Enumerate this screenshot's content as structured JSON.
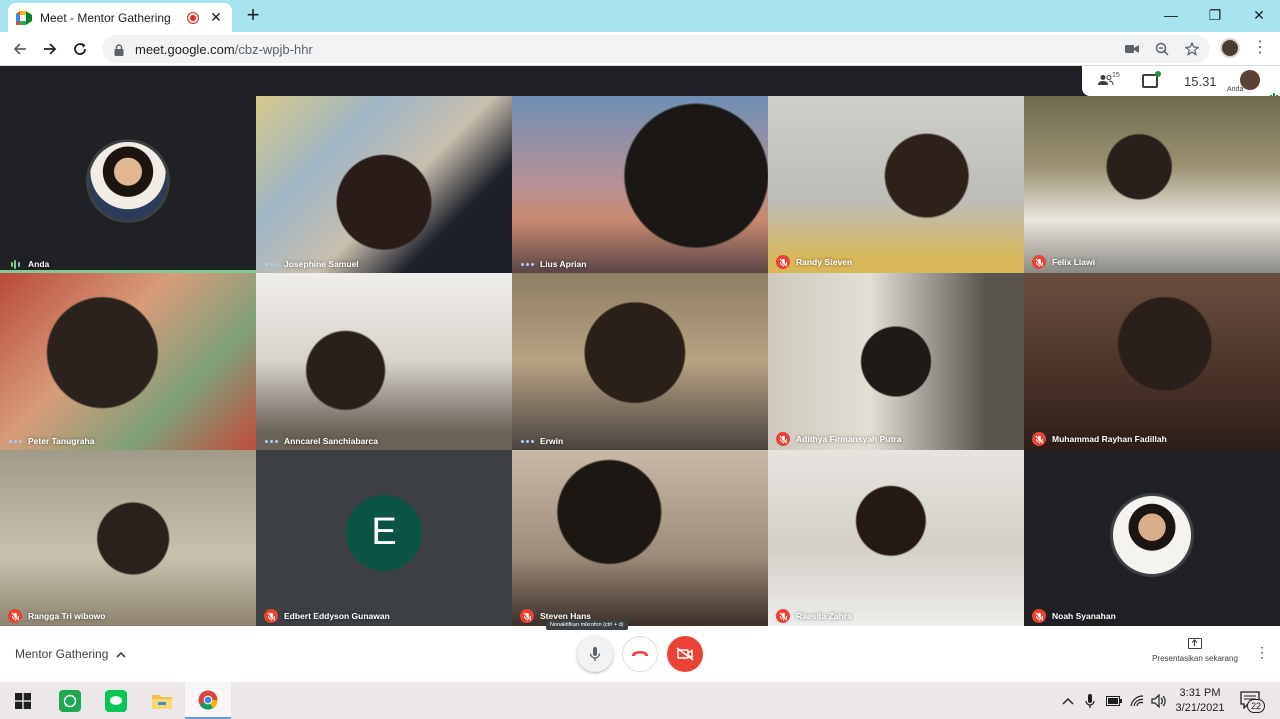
{
  "browser": {
    "tab_title": "Meet - Mentor Gathering",
    "tab_close": "✕",
    "new_tab": "+",
    "url_host": "meet.google.com",
    "url_path": "/cbz-wpjb-hhr",
    "window_minimize": "—",
    "window_restore": "❐",
    "window_close": "✕"
  },
  "meet_info": {
    "participants_count": "15",
    "time": "15.31",
    "you_label": "Anda"
  },
  "participants": [
    {
      "name": "Anda",
      "status": "speaking-self",
      "kind": "photo-avatar"
    },
    {
      "name": "Josephine Samuel",
      "status": "active",
      "kind": "video"
    },
    {
      "name": "Lius Aprian",
      "status": "active",
      "kind": "video"
    },
    {
      "name": "Randy Steven",
      "status": "muted",
      "kind": "video"
    },
    {
      "name": "Felix Liawi",
      "status": "muted",
      "kind": "video"
    },
    {
      "name": "Peter Tanugraha",
      "status": "active",
      "kind": "video"
    },
    {
      "name": "Anncarel Sanchiabarca",
      "status": "active",
      "kind": "video"
    },
    {
      "name": "Erwin",
      "status": "active",
      "kind": "video"
    },
    {
      "name": "Adithya Firmansyah Putra",
      "status": "muted",
      "kind": "video"
    },
    {
      "name": "Muhammad Rayhan Fadillah",
      "status": "muted",
      "kind": "video"
    },
    {
      "name": "Rangga Tri wibowo",
      "status": "muted",
      "kind": "video"
    },
    {
      "name": "Edbert Eddyson Gunawan",
      "status": "muted",
      "kind": "letter",
      "letter": "E"
    },
    {
      "name": "Steven Hans",
      "status": "muted",
      "kind": "video"
    },
    {
      "name": "Raesita Zahra",
      "status": "muted",
      "kind": "video"
    },
    {
      "name": "Noah Syanahan",
      "status": "muted",
      "kind": "photo-avatar"
    }
  ],
  "controls": {
    "meeting_name": "Mentor Gathering",
    "mic_tooltip": "Nonaktifkan mikrofon (ctrl + d)",
    "present_label": "Presentasikan sekarang"
  },
  "taskbar": {
    "time": "3:31 PM",
    "date": "3/21/2021",
    "notifications": "22"
  },
  "colors": {
    "tab_strip": "#a8e4f0",
    "meet_bg": "#202124",
    "mute_red": "#ea4335",
    "letter_avatar": "#0b5345"
  }
}
